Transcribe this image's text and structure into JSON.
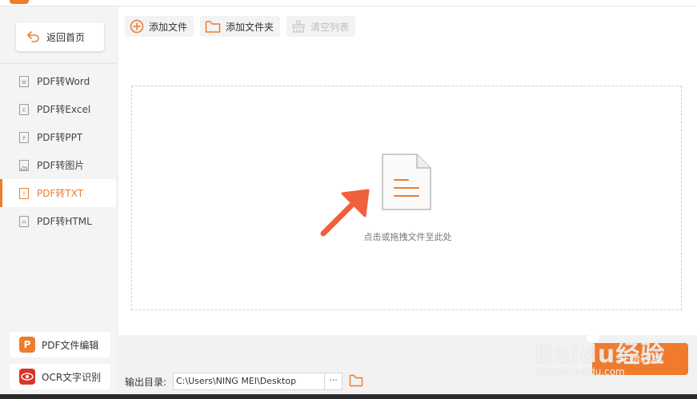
{
  "sidebar": {
    "back_label": "返回首页",
    "items": [
      {
        "label": "PDF转Word",
        "glyph": "W",
        "active": false
      },
      {
        "label": "PDF转Excel",
        "glyph": "E",
        "active": false
      },
      {
        "label": "PDF转PPT",
        "glyph": "P",
        "active": false
      },
      {
        "label": "PDF转图片",
        "glyph": "",
        "active": false
      },
      {
        "label": "PDF转TXT",
        "glyph": "T",
        "active": true
      },
      {
        "label": "PDF转HTML",
        "glyph": "H",
        "active": false
      }
    ],
    "tools": [
      {
        "label": "PDF文件编辑",
        "icon": "pdf-edit-icon",
        "glyph": "P",
        "color": "#f07b2d"
      },
      {
        "label": "OCR文字识别",
        "icon": "ocr-eye-icon",
        "glyph": "",
        "color": "#d9342b"
      }
    ]
  },
  "toolbar": {
    "add_file": "添加文件",
    "add_folder": "添加文件夹",
    "clear_list": "清空列表"
  },
  "dropzone": {
    "hint": "点击或拖拽文件至此处"
  },
  "output": {
    "label": "输出目录:",
    "path": "C:\\Users\\NING MEI\\Desktop",
    "more": "···"
  },
  "convert_label": "开始转换",
  "watermark": {
    "main": "Baidu经验",
    "sub": "jingyan.baidu.com"
  },
  "colors": {
    "accent": "#f07b2d",
    "ocr": "#d9342b",
    "sidebar_bg": "#f4f4f4",
    "main_bg": "#ffffff"
  }
}
